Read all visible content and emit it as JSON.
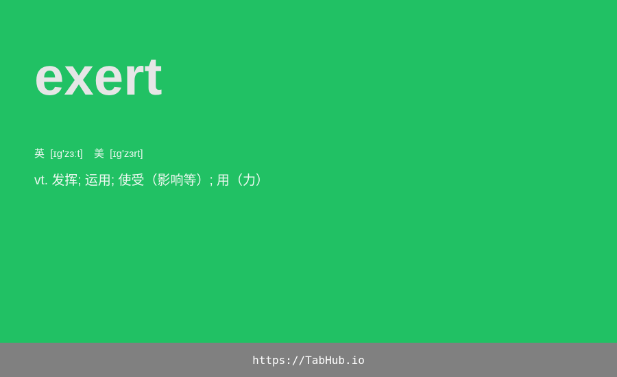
{
  "colors": {
    "background": "#21c164",
    "footer_background": "#808080",
    "word_color": "#e6e6e6",
    "text_color": "#eef8f1"
  },
  "card": {
    "word": "exert",
    "phonetics": {
      "uk_label": "英",
      "uk_ipa": "[ɪɡ'zɜːt]",
      "us_label": "美",
      "us_ipa": "[ɪɡ'zɜrt]"
    },
    "definition": "vt. 发挥; 运用; 使受（影响等）; 用（力）"
  },
  "footer": {
    "link_text": "https://TabHub.io"
  }
}
